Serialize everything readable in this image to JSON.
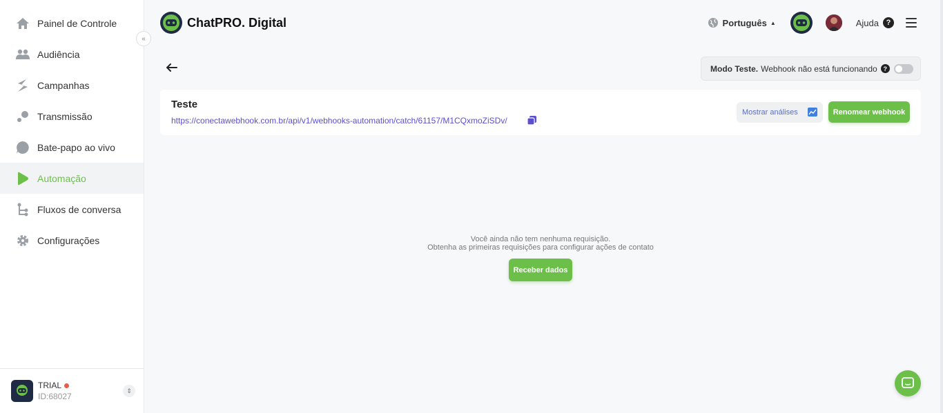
{
  "app": {
    "brand_name": "ChatPRO. Digital"
  },
  "sidebar": {
    "items": [
      {
        "label": "Painel de Controle",
        "icon": "home-icon"
      },
      {
        "label": "Audiência",
        "icon": "people-icon"
      },
      {
        "label": "Campanhas",
        "icon": "campaign-icon"
      },
      {
        "label": "Transmissão",
        "icon": "broadcast-icon"
      },
      {
        "label": "Bate-papo ao vivo",
        "icon": "chat-bubble-icon"
      },
      {
        "label": "Automação",
        "icon": "play-icon",
        "active": true
      },
      {
        "label": "Fluxos de conversa",
        "icon": "flow-icon"
      },
      {
        "label": "Configurações",
        "icon": "gear-icon"
      }
    ],
    "account": {
      "plan": "TRIAL",
      "id": "ID:68027"
    }
  },
  "header": {
    "language": "Português",
    "help_label": "Ajuda"
  },
  "test_mode": {
    "label": "Modo Teste.",
    "status": "Webhook não está funcionando",
    "enabled": false
  },
  "webhook": {
    "name": "Teste",
    "url": "https://conectawebhook.com.br/api/v1/webhooks-automation/catch/61157/M1CQxmoZiSDv/",
    "show_analytics_label": "Mostrar análises",
    "rename_label": "Renomear webhook"
  },
  "empty_state": {
    "line1": "Você ainda não tem nenhuma requisição.",
    "line2": "Obtenha as primeiras requisições para configurar ações de contato",
    "button_label": "Receber dados"
  },
  "colors": {
    "accent": "#6cc04a",
    "link": "#5b4fd0",
    "brand_dark": "#1f2a44"
  }
}
